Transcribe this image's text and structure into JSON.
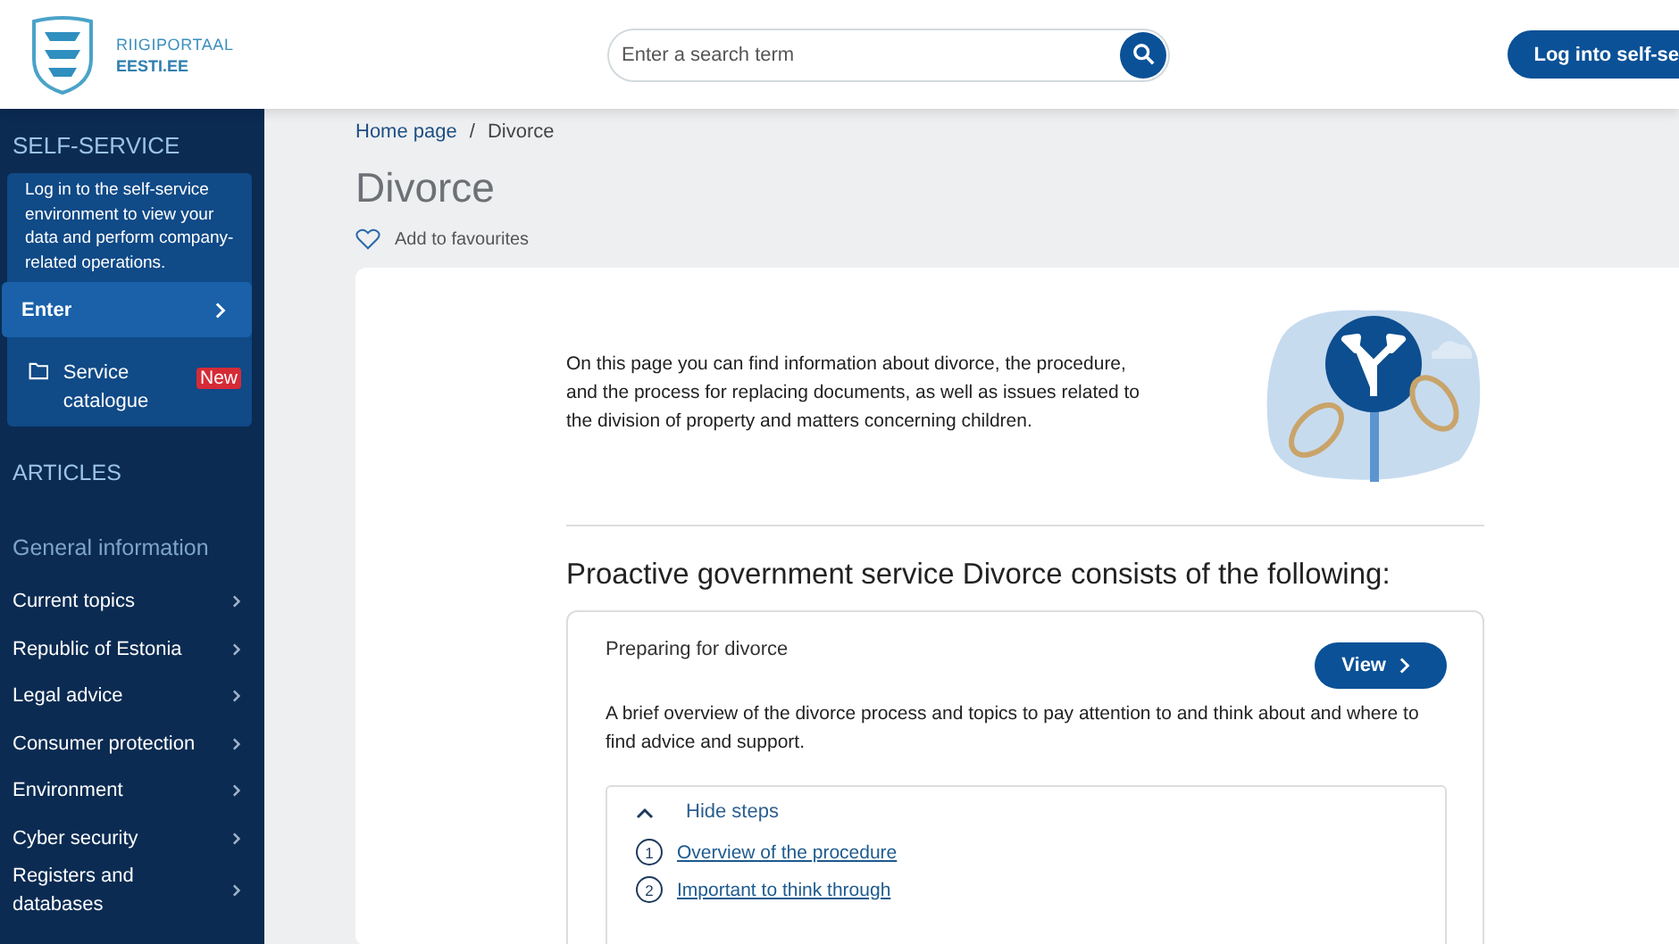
{
  "header": {
    "logo": {
      "line_1": "RIIGIPORTAAL",
      "line_2": "EESTI.EE"
    },
    "search": {
      "placeholder": "Enter a search term"
    },
    "login_button": "Log into self-se"
  },
  "sidebar": {
    "self_service": {
      "heading": "SELF-SERVICE",
      "text": "Log in to the self-service environment to view your data and perform company-related operations.",
      "enter": "Enter",
      "catalogue": {
        "label": "Service catalogue",
        "badge": "New"
      }
    },
    "articles_heading": "ARTICLES",
    "section_heading": "General information",
    "items": [
      {
        "label": "Current topics"
      },
      {
        "label": "Republic of Estonia"
      },
      {
        "label": "Legal advice"
      },
      {
        "label": "Consumer protection"
      },
      {
        "label": "Environment"
      },
      {
        "label": "Cyber security"
      },
      {
        "label": "Registers and databases"
      }
    ]
  },
  "breadcrumb": [
    {
      "label": "Home page",
      "kind": "link"
    },
    {
      "label": "/",
      "kind": "separator"
    },
    {
      "label": "Divorce",
      "kind": "current"
    }
  ],
  "page_title": "Divorce",
  "favourite": {
    "label": "Add to favourites",
    "on": false
  },
  "intro": "On this page you can find information about divorce, the procedure, and the process for replacing documents, as well as issues related to the division of property and matters concerning children.",
  "service_heading": "Proactive government service Divorce consists of the following:",
  "service_card": {
    "title": "Preparing for divorce",
    "button": "View",
    "description": "A brief overview of the divorce process and topics to pay attention to and think about and where to find advice and support.",
    "steps": {
      "toggle": "Hide steps",
      "expanded": true,
      "items": [
        {
          "number": "1",
          "label": "Overview of the procedure"
        },
        {
          "number": "2",
          "label": "Important to think through"
        }
      ]
    }
  }
}
